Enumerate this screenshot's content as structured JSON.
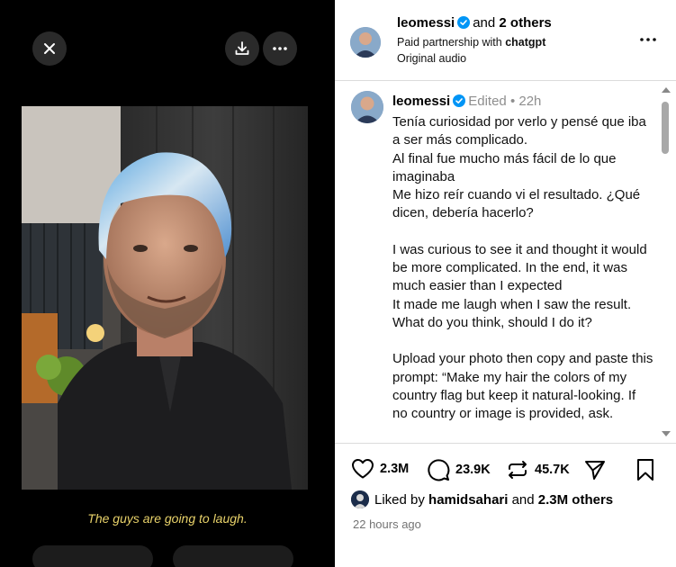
{
  "media": {
    "subtitle": "The guys are going to laugh.",
    "icons": {
      "close": "close-icon",
      "download": "download-icon",
      "more": "more-horizontal-icon"
    }
  },
  "header": {
    "username": "leomessi",
    "and_text": "and",
    "others_text": "2 others",
    "partnership_prefix": "Paid partnership with",
    "partner": "chatgpt",
    "audio": "Original audio"
  },
  "caption": {
    "username": "leomessi",
    "edited": "Edited",
    "separator": "•",
    "age": "22h",
    "spanish": "Tenía curiosidad por verlo y pensé que iba a ser más complicado.\n Al final fue mucho más fácil de lo que imaginaba\nMe hizo reír cuando vi el resultado. ¿Qué dicen, debería hacerlo?",
    "english": "I was curious to see it and thought it would be more complicated. In the end, it was much easier than I expected\nIt made me laugh when I saw the result. What do you think, should I do it?",
    "prompt": "Upload your photo then copy and paste this prompt: “Make my hair the colors of my country flag but keep it natural-looking. If no country or image is provided, ask."
  },
  "actions": {
    "likes": "2.3M",
    "comments": "23.9K",
    "reposts": "45.7K"
  },
  "liked_by": {
    "prefix": "Liked by",
    "user": "hamidsahari",
    "and": "and",
    "others": "2.3M others"
  },
  "timestamp": "22 hours ago",
  "colors": {
    "verified": "#0095f6",
    "muted": "#8e8e8e",
    "subtitle": "#e8d26a"
  }
}
